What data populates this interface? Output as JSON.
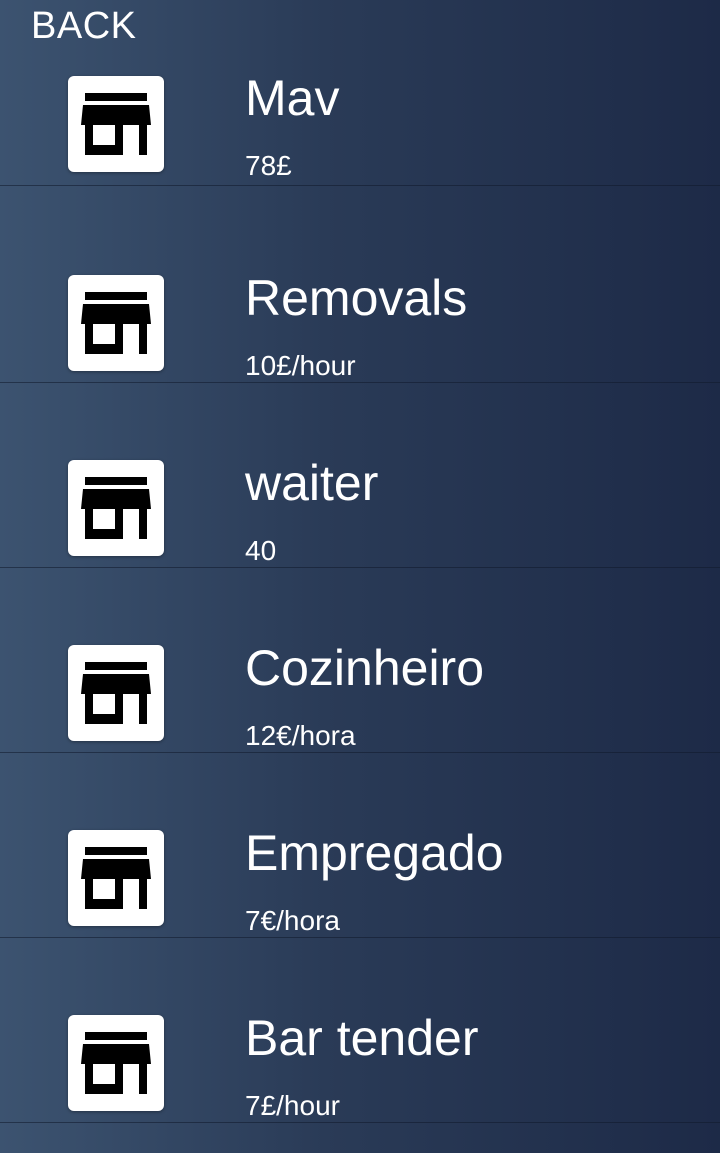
{
  "header": {
    "back_label": "BACK"
  },
  "jobs": [
    {
      "title": "Mav",
      "price": "78£",
      "icon": "store-icon"
    },
    {
      "title": "Removals",
      "price": "10£/hour",
      "icon": "store-icon"
    },
    {
      "title": "waiter",
      "price": "40",
      "icon": "store-icon"
    },
    {
      "title": "Cozinheiro",
      "price": "12€/hora",
      "icon": "store-icon"
    },
    {
      "title": "Empregado",
      "price": "7€/hora",
      "icon": "store-icon"
    },
    {
      "title": "Bar tender",
      "price": "7£/hour",
      "icon": "store-icon"
    }
  ],
  "colors": {
    "background_start": "#3c5370",
    "background_end": "#1d2a47",
    "text": "#ffffff",
    "icon_tile": "#ffffff",
    "icon_glyph": "#000000"
  }
}
